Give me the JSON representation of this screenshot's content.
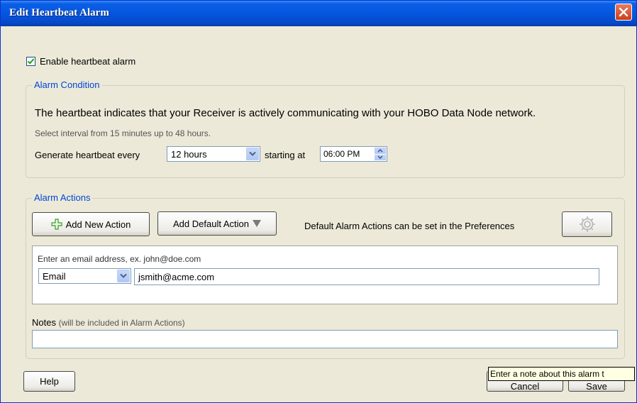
{
  "window": {
    "title": "Edit Heartbeat Alarm"
  },
  "enable": {
    "label": "Enable heartbeat alarm",
    "checked": true
  },
  "alarm_condition": {
    "legend": "Alarm Condition",
    "description": "The heartbeat indicates that your Receiver is actively communicating with your HOBO Data Node network.",
    "hint": "Select interval from 15 minutes up to 48 hours.",
    "generate_label": "Generate heartbeat every",
    "interval_value": "12 hours",
    "starting_label": "starting at",
    "start_time": "06:00 PM"
  },
  "alarm_actions": {
    "legend": "Alarm Actions",
    "add_new_label": "Add New Action",
    "add_default_label": "Add Default Action",
    "default_note": "Default Alarm Actions can be set in the Preferences",
    "email_hint": "Enter an email address, ex. john@doe.com",
    "action_type": "Email",
    "email_value": "jsmith@acme.com",
    "notes_label": "Notes",
    "notes_sub": "(will be included in Alarm Actions)"
  },
  "footer": {
    "help_label": "Help",
    "cancel_label": "Cancel",
    "save_label": "Save"
  },
  "tooltip": {
    "text": "Enter a note about this alarm t"
  },
  "colors": {
    "title_bar": "#0656e0",
    "legend": "#0046d5",
    "background": "#ece9d8",
    "close": "#c9401c"
  }
}
